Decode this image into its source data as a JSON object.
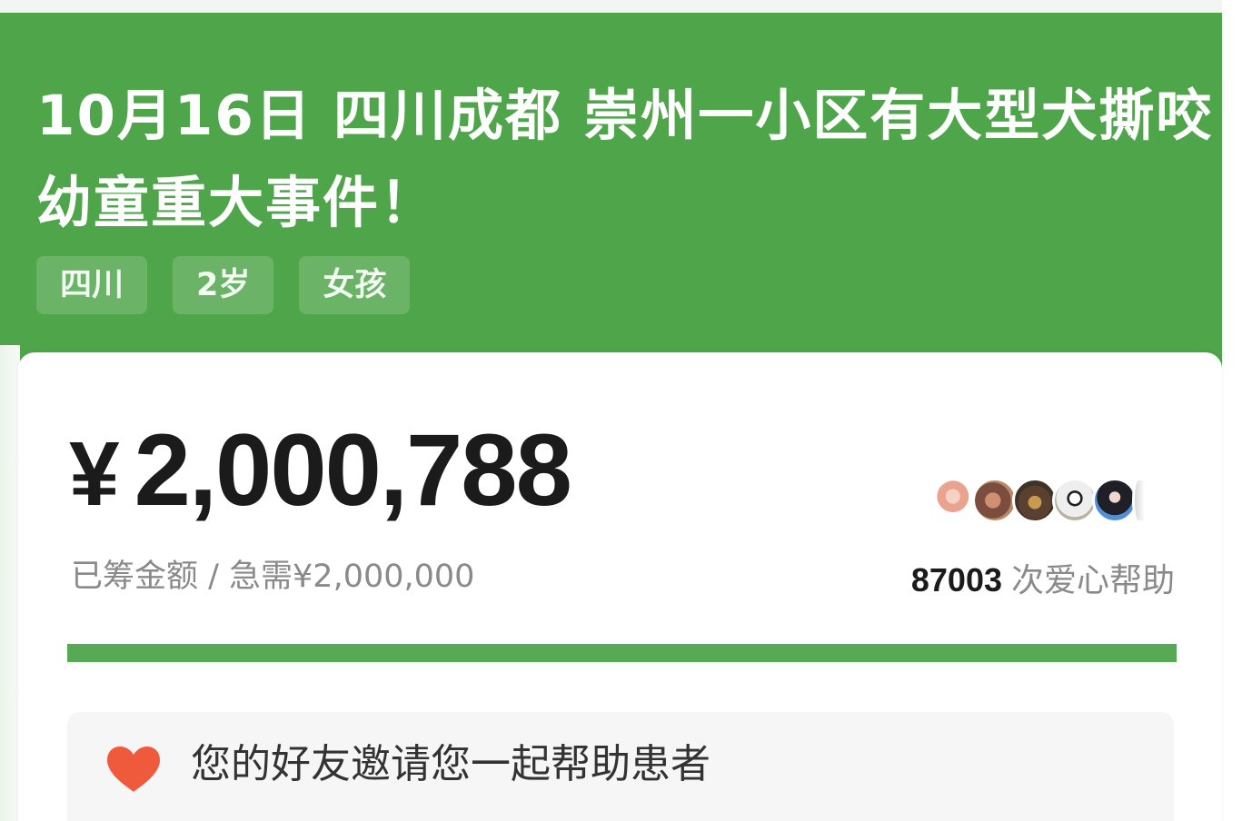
{
  "header": {
    "title": "10月16日 四川成都 崇州一小区有大型犬撕咬幼童重大事件！",
    "tags": [
      "四川",
      "2岁",
      "女孩"
    ]
  },
  "fundraise": {
    "currency_symbol": "¥",
    "amount": "2,000,788",
    "raised_label": "已筹金额 / 急需¥2,000,000",
    "help_count": "87003",
    "help_label": "次爱心帮助",
    "progress_fraction": 1.0
  },
  "invite": {
    "text": "您的好友邀请您一起帮助患者",
    "icon": "heart-icon"
  },
  "colors": {
    "brand_green": "#4ea54a",
    "progress_green": "#56aa55",
    "heart_red": "#f05a3c"
  },
  "avatars": [
    "avatar-1",
    "avatar-2",
    "avatar-3",
    "avatar-4",
    "avatar-5",
    "avatar-6"
  ]
}
